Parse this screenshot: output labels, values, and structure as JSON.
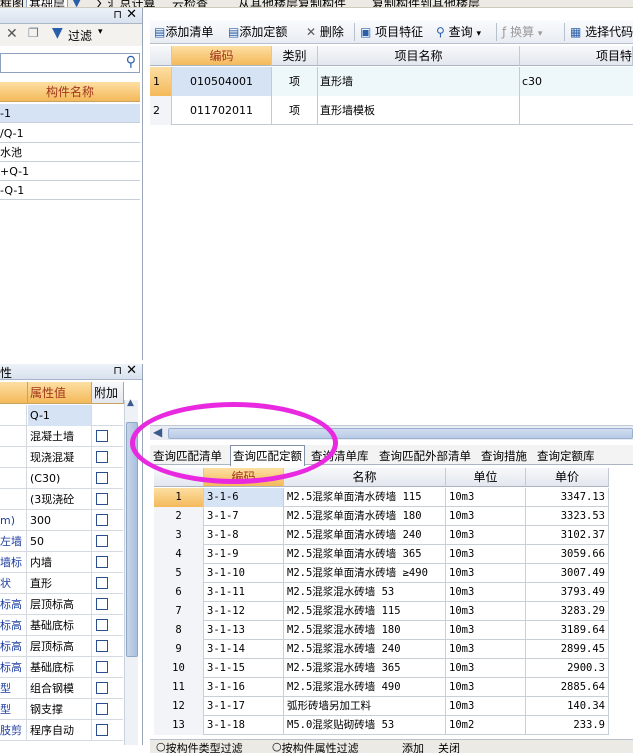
{
  "topbar": {
    "items": [
      "框图",
      "基础层",
      "Σ 汇总计算",
      "云检查",
      "从其他楼层复制构件",
      "复制构件到其他楼层"
    ]
  },
  "component_panel": {
    "pin": "⊓",
    "close": "✕",
    "filter_label": "过滤",
    "header": "构件名称",
    "items": [
      "-1",
      "/Q-1",
      "水池",
      "+Q-1",
      "-Q-1"
    ]
  },
  "property_panel": {
    "title": "性",
    "pin": "⊓",
    "close": "✕",
    "headers": {
      "value": "属性值",
      "extra": "附加"
    },
    "rows": [
      {
        "name": "",
        "value": "Q-1",
        "check": false
      },
      {
        "name": "",
        "value": "混凝土墙",
        "check": true
      },
      {
        "name": "",
        "value": "现浇混凝",
        "check": true
      },
      {
        "name": "",
        "value": "(C30)",
        "check": true
      },
      {
        "name": "",
        "value": "(3现浇砼",
        "check": true
      },
      {
        "name": "m)",
        "value": "300",
        "check": true
      },
      {
        "name": "左墙",
        "value": "50",
        "check": true
      },
      {
        "name": "墙标",
        "value": "内墙",
        "check": true
      },
      {
        "name": "状",
        "value": "直形",
        "check": true
      },
      {
        "name": "标高",
        "value": "层顶标高",
        "check": true
      },
      {
        "name": "标高",
        "value": "基础底标",
        "check": true
      },
      {
        "name": "标高",
        "value": "层顶标高",
        "check": true
      },
      {
        "name": "标高",
        "value": "基础底标",
        "check": true
      },
      {
        "name": "型",
        "value": "组合钢模",
        "check": true
      },
      {
        "name": "型",
        "value": "钢支撑",
        "check": true
      },
      {
        "name": "肢剪",
        "value": "程序自动",
        "check": true
      }
    ]
  },
  "toolbar": {
    "add_list": "添加清单",
    "add_quota": "添加定额",
    "delete": "删除",
    "item_feature": "项目特征",
    "query": "查询",
    "convert": "换算",
    "select_code": "选择代码"
  },
  "list_grid": {
    "headers": [
      "编码",
      "类别",
      "项目名称",
      "项目特"
    ],
    "rows": [
      {
        "idx": "1",
        "code": "010504001",
        "type": "项",
        "name": "直形墙",
        "feature": "c30"
      },
      {
        "idx": "2",
        "code": "011702011",
        "type": "项",
        "name": "直形墙模板",
        "feature": ""
      }
    ]
  },
  "tabs": [
    "查询匹配清单",
    "查询匹配定额",
    "查询清单库",
    "查询匹配外部清单",
    "查询措施",
    "查询定额库"
  ],
  "quota_grid": {
    "headers": [
      "编码",
      "名称",
      "单位",
      "单价"
    ],
    "rows": [
      {
        "idx": "1",
        "code": "3-1-6",
        "name": "M2.5混浆单面清水砖墙 115",
        "unit": "10m3",
        "price": "3347.13"
      },
      {
        "idx": "2",
        "code": "3-1-7",
        "name": "M2.5混浆单面清水砖墙 180",
        "unit": "10m3",
        "price": "3323.53"
      },
      {
        "idx": "3",
        "code": "3-1-8",
        "name": "M2.5混浆单面清水砖墙 240",
        "unit": "10m3",
        "price": "3102.37"
      },
      {
        "idx": "4",
        "code": "3-1-9",
        "name": "M2.5混浆单面清水砖墙 365",
        "unit": "10m3",
        "price": "3059.66"
      },
      {
        "idx": "5",
        "code": "3-1-10",
        "name": "M2.5混浆单面清水砖墙 ≥490",
        "unit": "10m3",
        "price": "3007.49"
      },
      {
        "idx": "6",
        "code": "3-1-11",
        "name": "M2.5混浆混水砖墙 53",
        "unit": "10m3",
        "price": "3793.49"
      },
      {
        "idx": "7",
        "code": "3-1-12",
        "name": "M2.5混浆混水砖墙 115",
        "unit": "10m3",
        "price": "3283.29"
      },
      {
        "idx": "8",
        "code": "3-1-13",
        "name": "M2.5混浆混水砖墙 180",
        "unit": "10m3",
        "price": "3189.64"
      },
      {
        "idx": "9",
        "code": "3-1-14",
        "name": "M2.5混浆混水砖墙 240",
        "unit": "10m3",
        "price": "2899.45"
      },
      {
        "idx": "10",
        "code": "3-1-15",
        "name": "M2.5混浆混水砖墙 365",
        "unit": "10m3",
        "price": "2900.3"
      },
      {
        "idx": "11",
        "code": "3-1-16",
        "name": "M2.5混浆混水砖墙 490",
        "unit": "10m3",
        "price": "2885.64"
      },
      {
        "idx": "12",
        "code": "3-1-17",
        "name": "弧形砖墙另加工料",
        "unit": "10m3",
        "price": "140.34"
      },
      {
        "idx": "13",
        "code": "3-1-18",
        "name": "M5.0混浆贴砌砖墙 53",
        "unit": "10m2",
        "price": "233.9"
      }
    ]
  },
  "bottom_bar": [
    "按构件类型过滤",
    "按构件属性过滤",
    "添加",
    "关闭"
  ],
  "colors": {
    "header_orange": "#f4b95a",
    "selection": "#d6e3f5",
    "annotation": "#e829e0"
  }
}
